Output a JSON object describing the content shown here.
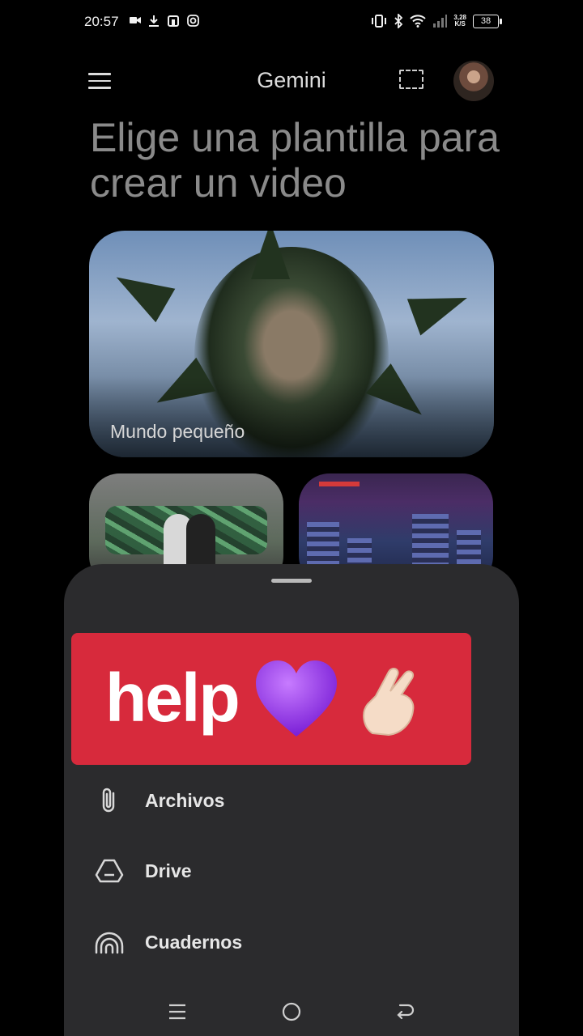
{
  "status_bar": {
    "time": "20:57",
    "speed_value": "3,28",
    "speed_unit": "K/S",
    "battery": "38"
  },
  "app_bar": {
    "title": "Gemini"
  },
  "headline": "Elige una plantilla para crear un video",
  "templates": [
    {
      "label": "Mundo pequeño"
    }
  ],
  "sticker": {
    "text": "help",
    "emojis": [
      "purple-heart",
      "crossed-fingers"
    ],
    "background": "#d72a3c"
  },
  "attach_options": [
    {
      "label": "Archivos",
      "icon": "paperclip-icon"
    },
    {
      "label": "Drive",
      "icon": "drive-icon"
    },
    {
      "label": "Cuadernos",
      "icon": "notebooks-icon"
    }
  ],
  "colors": {
    "sheet": "#2b2b2d",
    "background": "#000000"
  }
}
